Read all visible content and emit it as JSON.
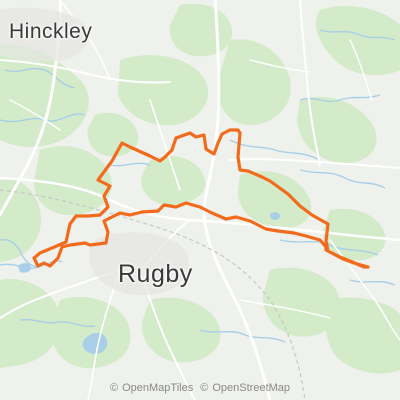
{
  "map": {
    "towns": {
      "hinckley": "Hinckley",
      "rugby": "Rugby"
    },
    "attribution": {
      "tiles_symbol": "©",
      "tiles_text": "OpenMapTiles",
      "osm_symbol": "©",
      "osm_text": "OpenStreetMap"
    },
    "colors": {
      "land": "#eef1ec",
      "woodland": "#cfe8c4",
      "water": "#a9cfe8",
      "road": "#ffffff",
      "route": "#f26b1d"
    },
    "route_icon": "route-line"
  }
}
